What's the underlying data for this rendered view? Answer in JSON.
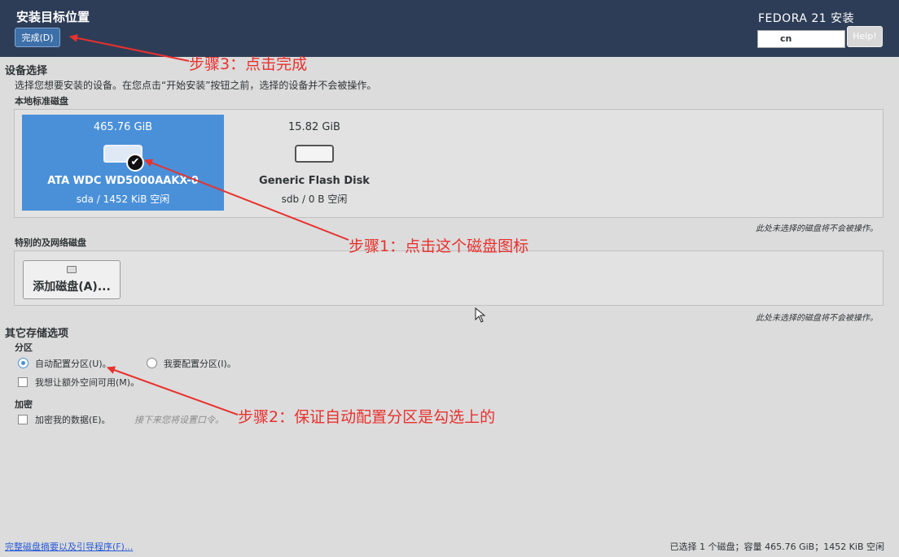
{
  "header": {
    "title": "安装目标位置",
    "done_button": "完成(D)",
    "product": "FEDORA 21 安装",
    "language": "cn",
    "help_button": "Help!"
  },
  "device_selection": {
    "title": "设备选择",
    "description": "选择您想要安装的设备。在您点击“开始安装”按钮之前，选择的设备并不会被操作。",
    "local_disks_label": "本地标准磁盘",
    "disks": [
      {
        "size": "465.76 GiB",
        "name": "ATA WDC WD5000AAKX-0",
        "info": "sda   /   1452 KiB 空闲",
        "selected": true
      },
      {
        "size": "15.82 GiB",
        "name": "Generic Flash Disk",
        "info": "sdb  /  0 B 空闲",
        "selected": false
      }
    ],
    "local_note": "此处未选择的磁盘将不会被操作。",
    "special_disks_label": "特别的及网络磁盘",
    "add_disk_button": "添加磁盘(A)...",
    "special_note": "此处未选择的磁盘将不会被操作。"
  },
  "other_options": {
    "title": "其它存储选项",
    "partitioning_label": "分区",
    "auto_partition": "自动配置分区(U)。",
    "manual_partition": "我要配置分区(I)。",
    "extra_space": "我想让额外空间可用(M)。",
    "encryption_label": "加密",
    "encrypt_data": "加密我的数据(E)。",
    "encrypt_hint": "接下来您将设置口令。"
  },
  "footer": {
    "summary_link": "完整磁盘摘要以及引导程序(F)...",
    "status": "已选择 1 个磁盘；容量 465.76 GiB；1452 KiB 空闲"
  },
  "annotations": {
    "step1": "步骤1：点击这个磁盘图标",
    "step2": "步骤2：保证自动配置分区是勾选上的",
    "step3": "步骤3：点击完成"
  },
  "colors": {
    "header_bg": "#2e3d57",
    "selected_disk": "#4a90d9",
    "annotation": "#e8312e"
  }
}
